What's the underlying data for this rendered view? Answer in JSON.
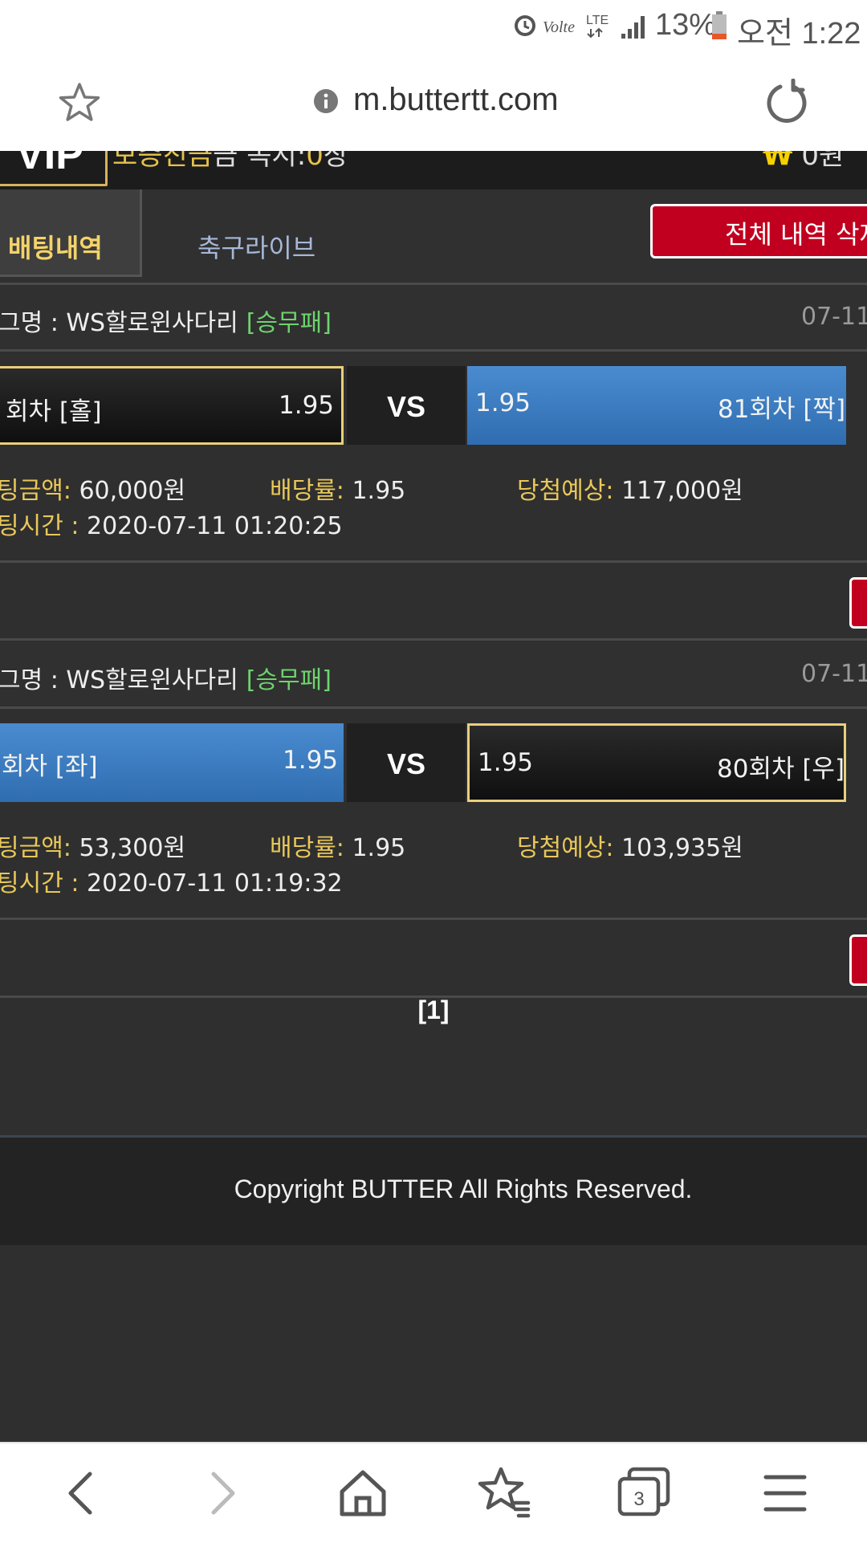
{
  "status_bar": {
    "battery": "13%",
    "time": "오전 1:22",
    "icons": [
      "alarm-icon",
      "volte-icon",
      "lte-icon",
      "signal-icon",
      "battery-icon"
    ]
  },
  "browser": {
    "url": "m.buttertt.com",
    "icons": [
      "star-icon",
      "info-icon",
      "reload-icon"
    ]
  },
  "site_header": {
    "vip": "VIP",
    "partial_left_a": "보증친금",
    "partial_left_b": "금  녹시:",
    "partial_left_c": "0",
    "partial_left_d": "장",
    "coin_symbol": "₩",
    "money": "0원"
  },
  "tabs": {
    "betting": "배팅내역",
    "live": "축구라이브",
    "delete_all": "전체 내역 삭제"
  },
  "bets": [
    {
      "league_prefix": "그명 : WS할로윈사다리",
      "league_tag": "[승무패]",
      "date": "07-11",
      "left_label": "회차 [홀]",
      "left_odds": "1.95",
      "vs": "VS",
      "right_odds": "1.95",
      "right_label": "81회차 [짝]",
      "amount_key": "팅금액:",
      "amount": "60,000원",
      "rate_key": "배당률:",
      "rate": "1.95",
      "expected_key": "당첨예상:",
      "expected": "117,000원",
      "time_key": "팅시간 :",
      "time": "2020-07-11 01:20:25"
    },
    {
      "league_prefix": "그명 : WS할로윈사다리",
      "league_tag": "[승무패]",
      "date": "07-11",
      "left_label": "회차 [좌]",
      "left_odds": "1.95",
      "vs": "VS",
      "right_odds": "1.95",
      "right_label": "80회차 [우]",
      "amount_key": "팅금액:",
      "amount": "53,300원",
      "rate_key": "배당률:",
      "rate": "1.95",
      "expected_key": "당첨예상:",
      "expected": "103,935원",
      "time_key": "팅시간 :",
      "time": "2020-07-11 01:19:32"
    }
  ],
  "pager": "[1]",
  "footer": "Copyright BUTTER All Rights Reserved.",
  "bottom_nav": {
    "tab_count": "3",
    "icons": [
      "back-icon",
      "forward-icon",
      "home-icon",
      "bookmarks-icon",
      "tabs-icon",
      "menu-icon"
    ]
  },
  "colors": {
    "accent_gold": "#e9cf7a",
    "blue_selection": "#3a7cc4",
    "red_button": "#c1001f",
    "green_tag": "#6ed36e"
  }
}
